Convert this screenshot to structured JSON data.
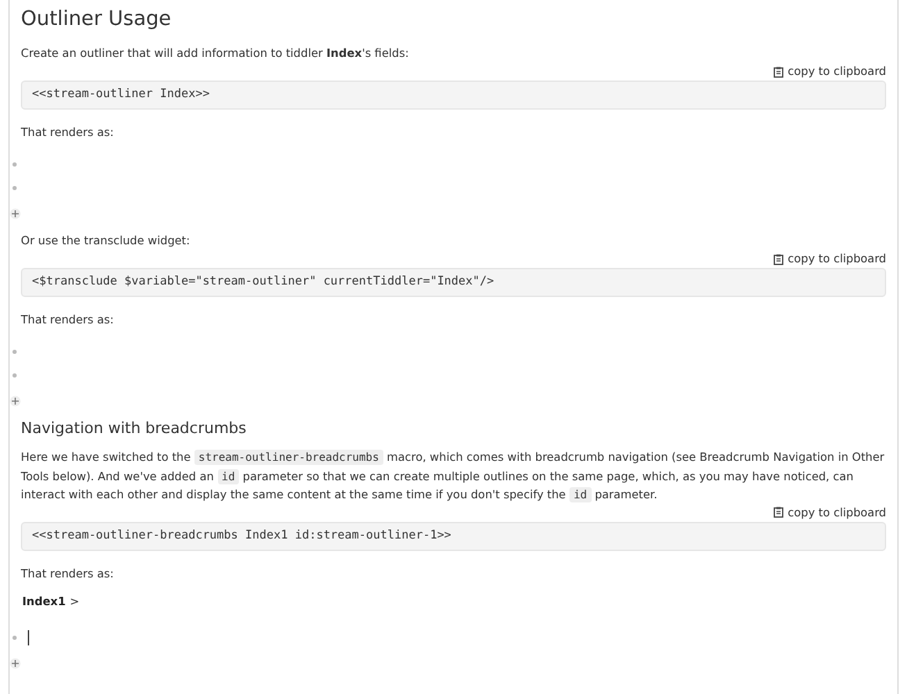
{
  "title": "Outliner Usage",
  "blocks": [
    {
      "kind": "paragraph",
      "text": "Create an outliner that will add information to tiddler **Index**'s fields:"
    },
    {
      "kind": "code",
      "copy": "copy to clipboard",
      "code": "<<stream-outliner Index>>"
    },
    {
      "kind": "paragraph",
      "text": "That renders as:"
    },
    {
      "kind": "outline",
      "items": [
        {
          "kind": "empty"
        },
        {
          "kind": "empty"
        }
      ]
    },
    {
      "kind": "paragraph",
      "text": "Or use the transclude widget:"
    },
    {
      "kind": "code",
      "copy": "copy to clipboard",
      "code": "<$transclude $variable=\"stream-outliner\" currentTiddler=\"Index\"/>"
    },
    {
      "kind": "paragraph",
      "text": "That renders as:"
    },
    {
      "kind": "outline",
      "items": [
        {
          "kind": "empty"
        },
        {
          "kind": "empty"
        }
      ]
    },
    {
      "kind": "heading",
      "text": "Navigation with breadcrumbs"
    },
    {
      "kind": "mixed",
      "parts": [
        {
          "kind": "text",
          "text": "Here we have switched to the "
        },
        {
          "kind": "code",
          "text": "stream-outliner-breadcrumbs"
        },
        {
          "kind": "text",
          "text": " macro, which comes with breadcrumb navigation (see Breadcrumb Navigation in Other Tools below). And we've added an "
        },
        {
          "kind": "code",
          "text": "id"
        },
        {
          "kind": "text",
          "text": " parameter so that we can create multiple outlines on the same page, which, as you may have noticed, can interact with each other and display the same content at the same time if you don't specify the "
        },
        {
          "kind": "code",
          "text": "id"
        },
        {
          "kind": "text",
          "text": " parameter."
        }
      ]
    },
    {
      "kind": "code",
      "copy": "copy to clipboard",
      "code": "<<stream-outliner-breadcrumbs Index1 id:stream-outliner-1>>"
    },
    {
      "kind": "paragraph",
      "text": "That renders as:"
    },
    {
      "kind": "breadcrumbs",
      "crumb": "Index1",
      "separator": ">"
    },
    {
      "kind": "outline",
      "items": [
        {
          "kind": "editing"
        }
      ]
    }
  ]
}
